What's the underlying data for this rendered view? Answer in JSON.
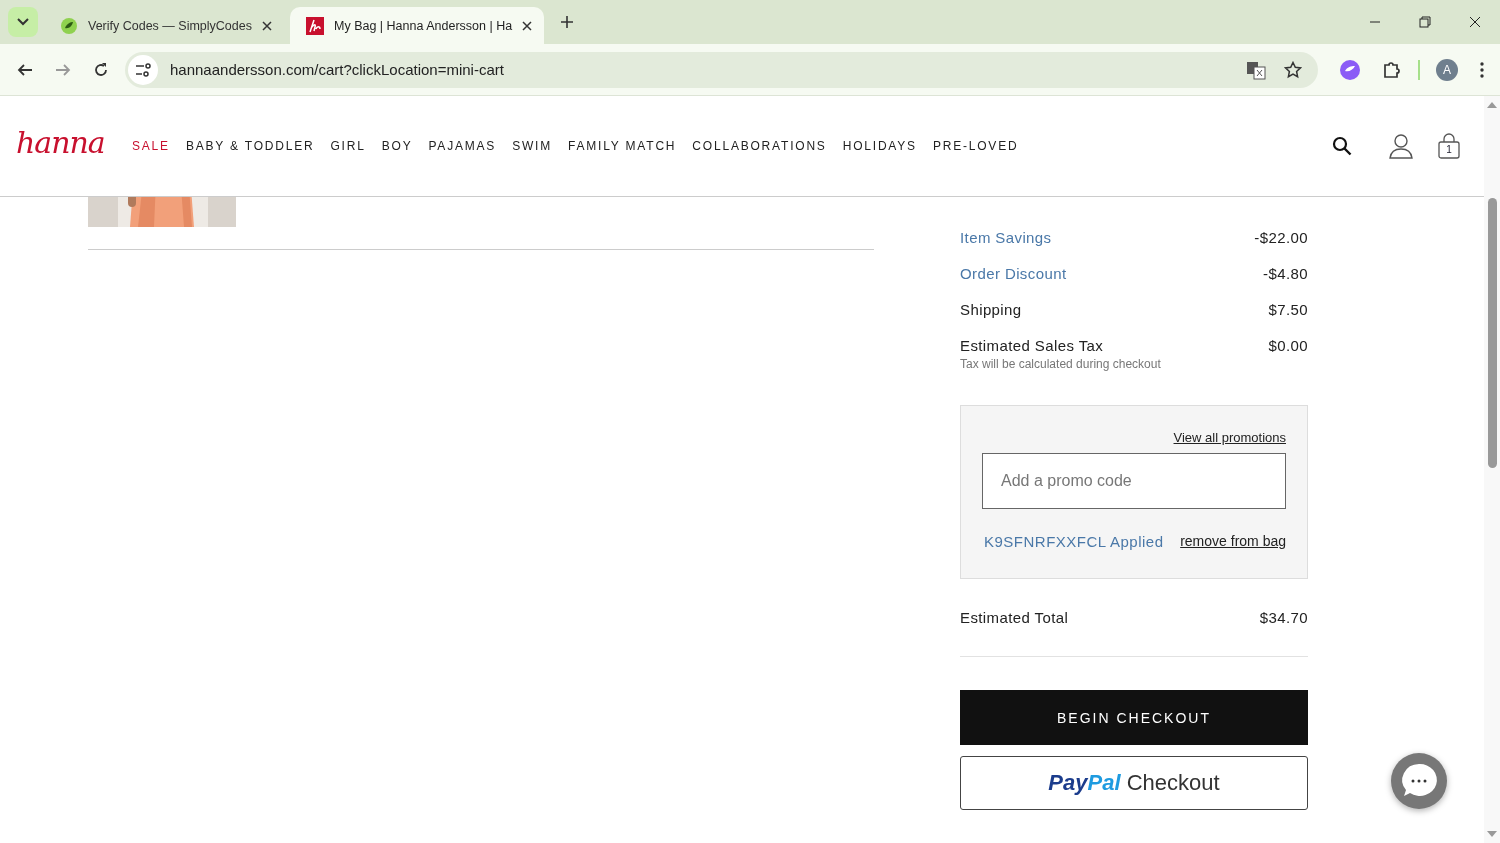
{
  "browser": {
    "tabs": [
      {
        "title": "Verify Codes — SimplyCodes",
        "selected": false,
        "kind": "simplycodes"
      },
      {
        "title": "My Bag | Hanna Andersson | Ha",
        "selected": true,
        "kind": "hanna"
      }
    ],
    "url": "hannaandersson.com/cart?clickLocation=mini-cart",
    "profile_initial": "A"
  },
  "header": {
    "logo": "hanna",
    "nav": [
      {
        "label": "SALE",
        "kind": "sale"
      },
      {
        "label": "BABY & TODDLER",
        "kind": "normal"
      },
      {
        "label": "GIRL",
        "kind": "normal"
      },
      {
        "label": "BOY",
        "kind": "normal"
      },
      {
        "label": "PAJAMAS",
        "kind": "normal"
      },
      {
        "label": "SWIM",
        "kind": "normal"
      },
      {
        "label": "FAMILY MATCH",
        "kind": "normal"
      },
      {
        "label": "COLLABORATIONS",
        "kind": "normal"
      },
      {
        "label": "HOLIDAYS",
        "kind": "normal"
      },
      {
        "label": "PRE-LOVED",
        "kind": "normal"
      }
    ],
    "bag_count": "1"
  },
  "summary": {
    "rows": [
      {
        "label": "Item Savings",
        "value": "-$22.00",
        "kind": "discount"
      },
      {
        "label": "Order Discount",
        "value": "-$4.80",
        "kind": "discount"
      },
      {
        "label": "Shipping",
        "value": "$7.50",
        "kind": "plain"
      },
      {
        "label": "Estimated Sales Tax",
        "value": "$0.00",
        "kind": "plain",
        "note": "Tax will be calculated during checkout"
      }
    ],
    "promo": {
      "view_all": "View all promotions",
      "placeholder": "Add a promo code",
      "applied": "K9SFNRFXXFCL Applied",
      "remove": "remove from bag"
    },
    "total": {
      "label": "Estimated Total",
      "value": "$34.70"
    },
    "checkout_button": "BEGIN CHECKOUT",
    "paypal": {
      "brand_parts": [
        "Pay",
        "Pal"
      ],
      "label": "Checkout"
    }
  }
}
